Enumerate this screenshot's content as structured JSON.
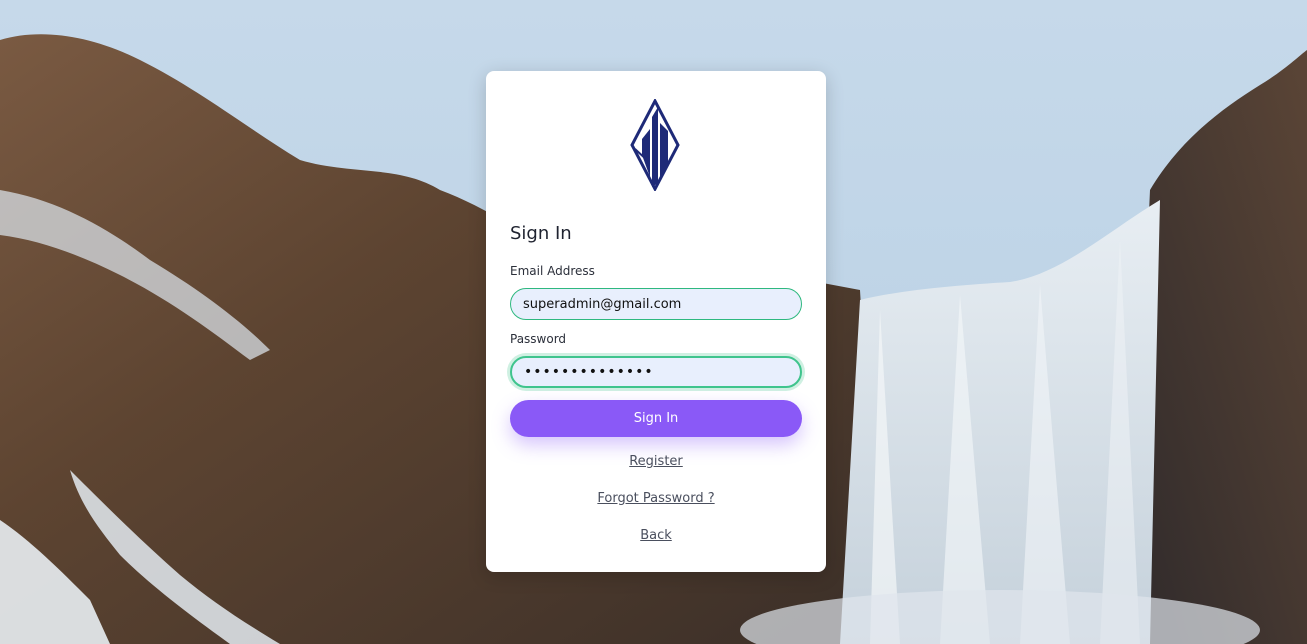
{
  "background": {
    "icon": "waterfall-landscape-image"
  },
  "logo": {
    "icon": "brand-diamond-logo-icon",
    "color": "#1e2a78"
  },
  "form": {
    "title": "Sign In",
    "email_label": "Email Address",
    "email_value": "superadmin@gmail.com",
    "password_label": "Password",
    "password_value": "••••••••••••••",
    "submit_label": "Sign In",
    "register_link": "Register",
    "forgot_link": "Forgot Password ?",
    "back_link": "Back"
  },
  "colors": {
    "accent": "#8a59f7",
    "input_border": "#2eb87f",
    "input_bg": "#e8effd"
  }
}
